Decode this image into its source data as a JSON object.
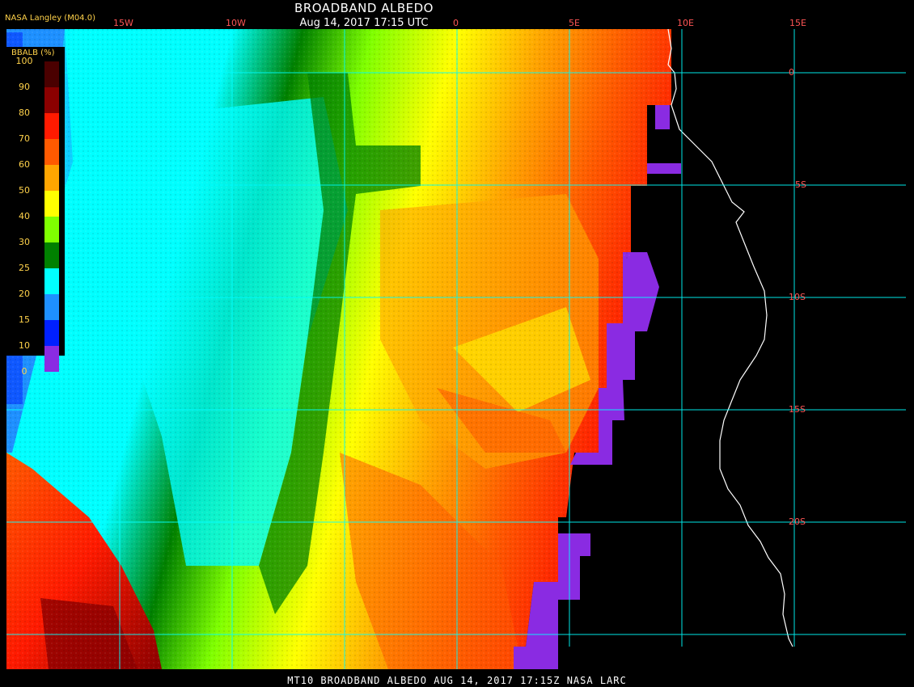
{
  "header": {
    "title": "BROADBAND ALBEDO",
    "subtitle": "Aug 14, 2017 17:15 UTC",
    "source": "NASA Langley (M04.0)"
  },
  "footer": {
    "caption": "MT10  BROADBAND ALBEDO   AUG 14, 2017 17:15Z   NASA LARC"
  },
  "legend": {
    "title": "BBALB (%)",
    "items": [
      {
        "label": "100",
        "color": "#4a0000"
      },
      {
        "label": "90",
        "color": "#8b0000"
      },
      {
        "label": "80",
        "color": "#ff1a00"
      },
      {
        "label": "70",
        "color": "#ff5a00"
      },
      {
        "label": "60",
        "color": "#ffa500"
      },
      {
        "label": "50",
        "color": "#ffff00"
      },
      {
        "label": "40",
        "color": "#7fff00"
      },
      {
        "label": "30",
        "color": "#008000"
      },
      {
        "label": "25",
        "color": "#00ffff"
      },
      {
        "label": "20",
        "color": "#1e90ff"
      },
      {
        "label": "15",
        "color": "#0020ff"
      },
      {
        "label": "10",
        "color": "#8a2be2"
      },
      {
        "label": "0",
        "color": "#000000"
      }
    ]
  },
  "axes": {
    "lon_labels": [
      "15W",
      "10W",
      "0",
      "5E",
      "10E",
      "15E"
    ],
    "lat_labels": [
      "0",
      "5S",
      "10S",
      "15S",
      "20S"
    ]
  },
  "colors": {
    "grid": "#00ffff",
    "tick_labels": "#ff5555",
    "coastline": "#ffffff",
    "background": "#000000"
  }
}
